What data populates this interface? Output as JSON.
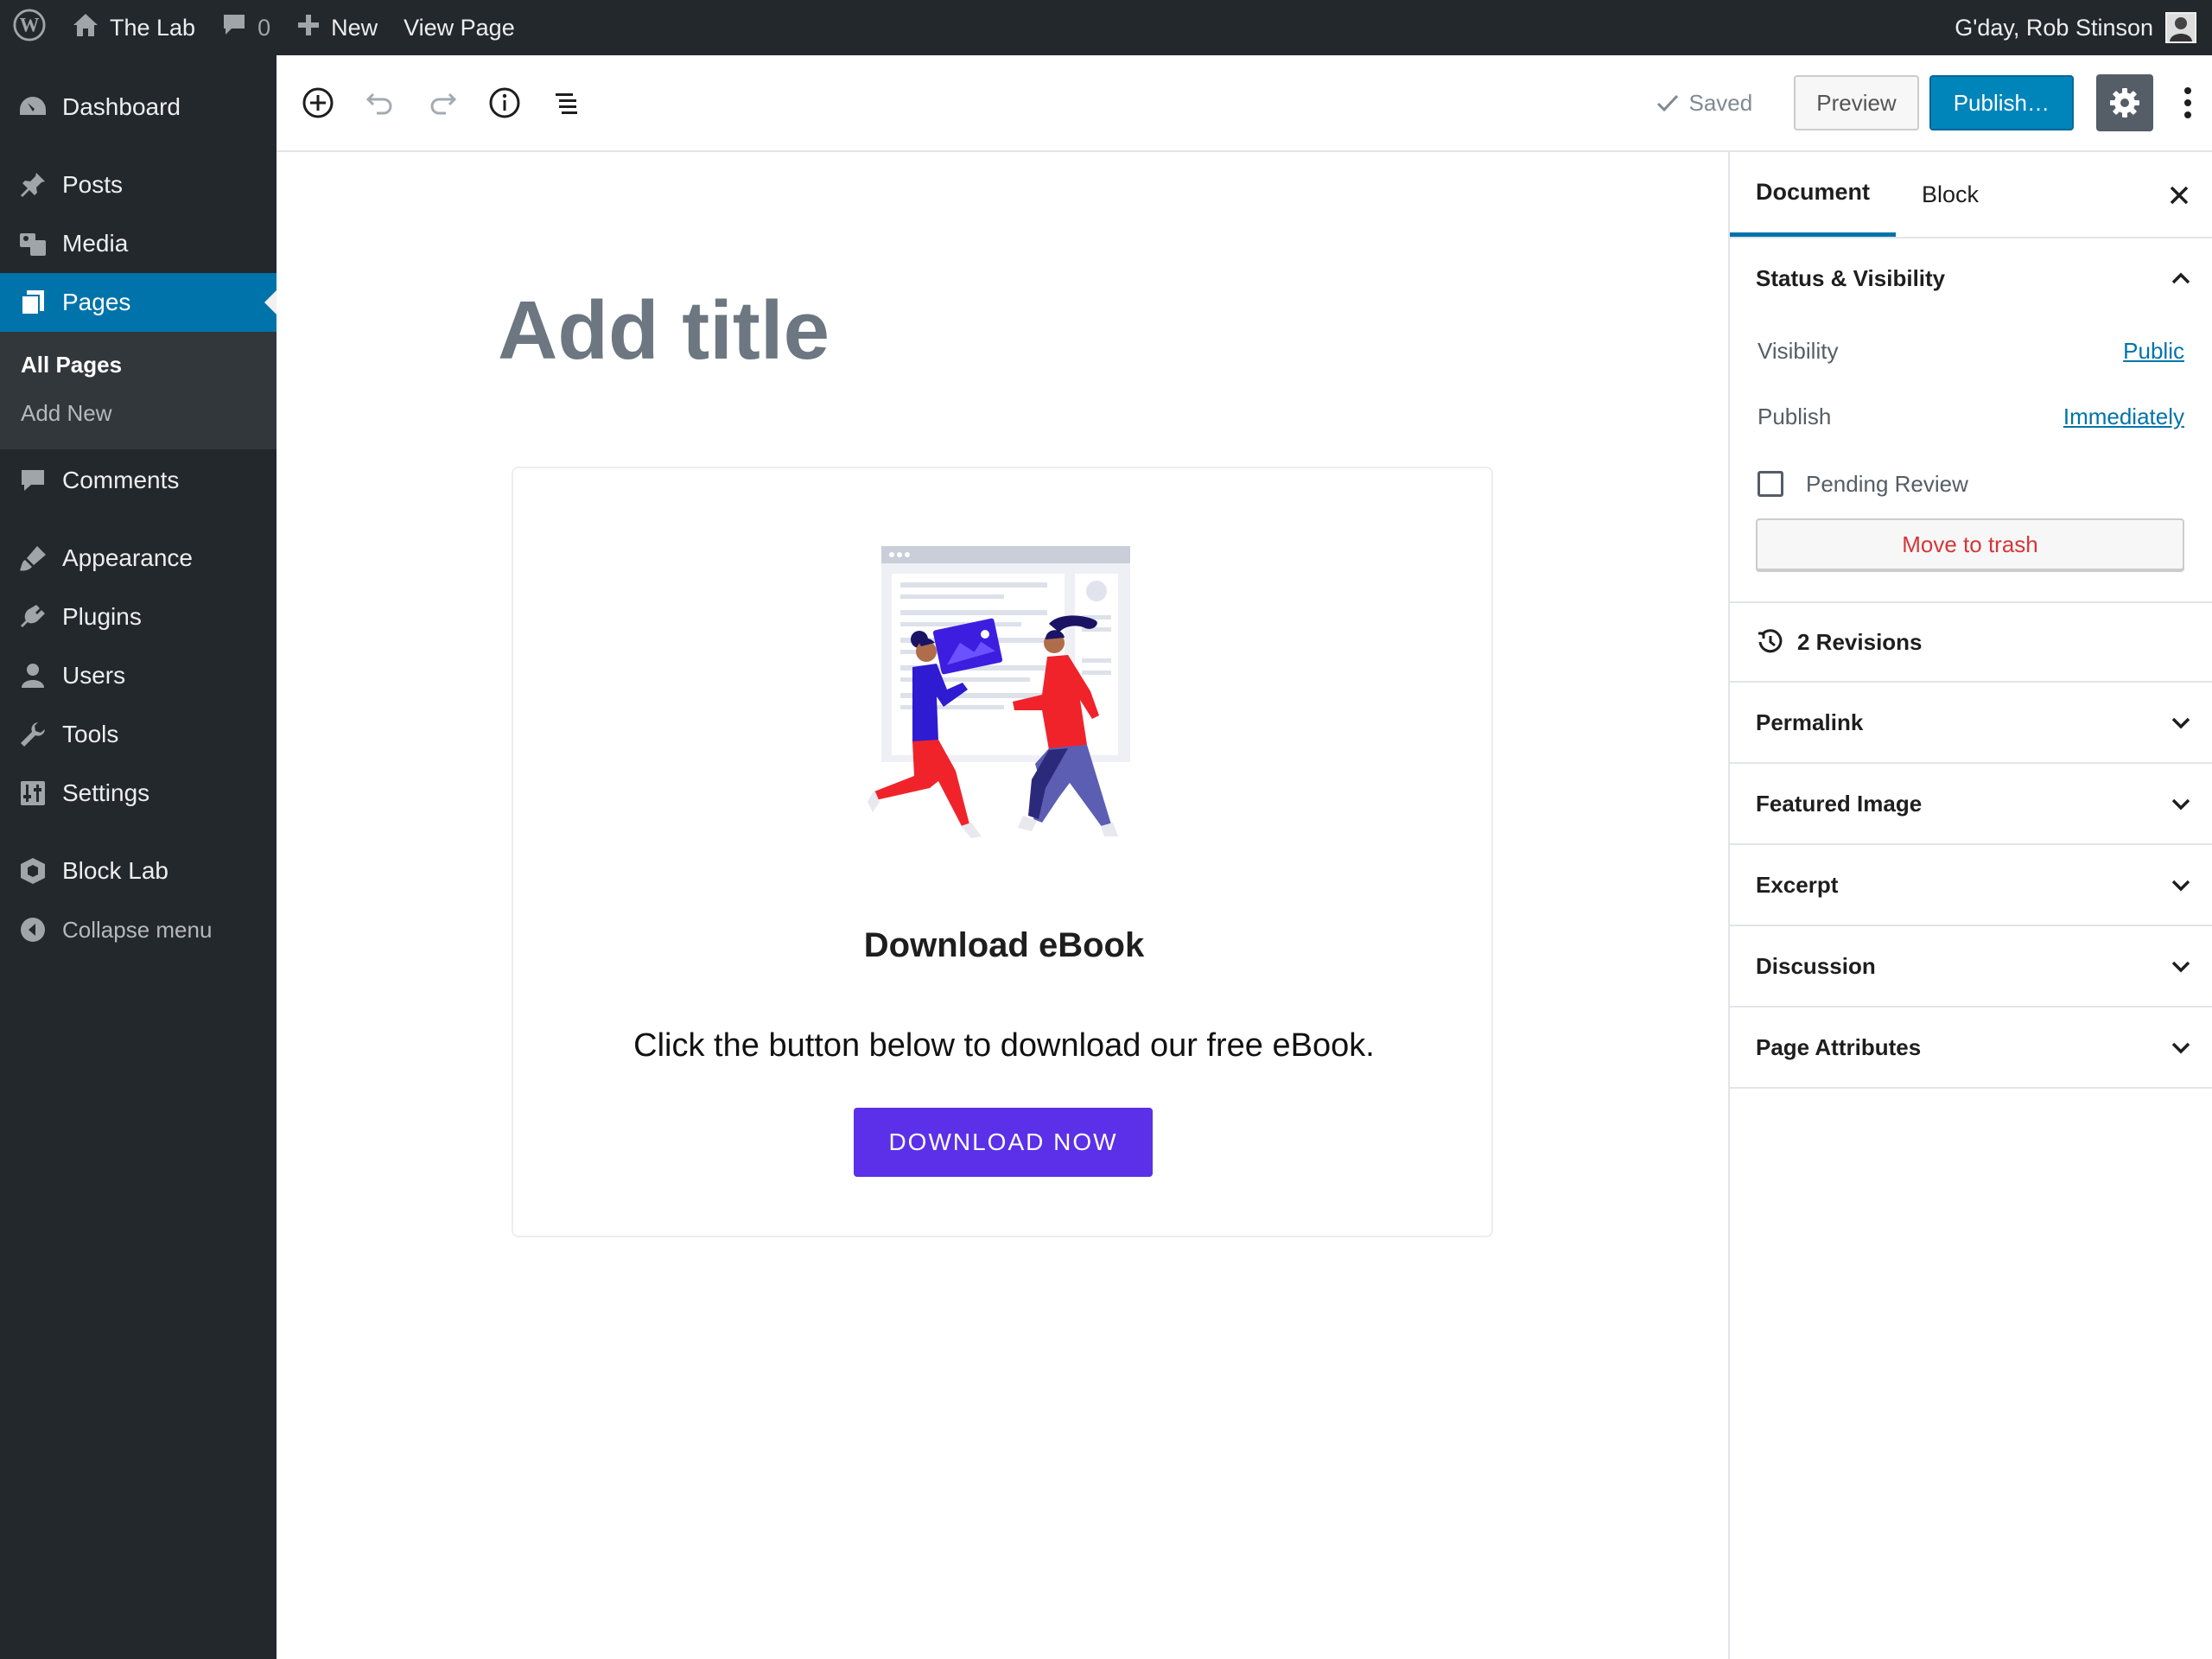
{
  "admin_bar": {
    "site_name": "The Lab",
    "comments_count": "0",
    "new_label": "New",
    "view_page_label": "View Page",
    "greeting": "G'day, Rob Stinson"
  },
  "sidebar": {
    "dashboard": "Dashboard",
    "posts": "Posts",
    "media": "Media",
    "pages": "Pages",
    "submenu": {
      "all_pages": "All Pages",
      "add_new": "Add New"
    },
    "comments": "Comments",
    "appearance": "Appearance",
    "plugins": "Plugins",
    "users": "Users",
    "tools": "Tools",
    "settings": "Settings",
    "block_lab": "Block Lab",
    "collapse": "Collapse menu"
  },
  "toolbar": {
    "saved_label": "Saved",
    "preview_label": "Preview",
    "publish_label": "Publish…"
  },
  "editor": {
    "title_placeholder": "Add title",
    "card": {
      "title": "Download eBook",
      "text": "Click the button below to download our free eBook.",
      "button_label": "DOWNLOAD NOW"
    }
  },
  "panel": {
    "tabs": {
      "document": "Document",
      "block": "Block"
    },
    "status_visibility": {
      "heading": "Status & Visibility",
      "visibility_label": "Visibility",
      "visibility_value": "Public",
      "publish_label": "Publish",
      "publish_value": "Immediately",
      "pending_review": "Pending Review",
      "trash_label": "Move to trash"
    },
    "revisions": "2 Revisions",
    "sections": {
      "permalink": "Permalink",
      "featured_image": "Featured Image",
      "excerpt": "Excerpt",
      "discussion": "Discussion",
      "page_attributes": "Page Attributes"
    }
  },
  "colors": {
    "admin_dark": "#23282d",
    "wp_blue": "#0073aa",
    "publish_blue": "#0085ba",
    "cta_purple": "#5b30e8",
    "trash_red": "#d63638"
  },
  "icons": [
    "wordpress-logo-icon",
    "home-icon",
    "comment-bubble-icon",
    "plus-icon",
    "dashboard-icon",
    "pin-icon",
    "media-icon",
    "pages-icon",
    "comments-icon",
    "appearance-icon",
    "plugins-icon",
    "users-icon",
    "tools-icon",
    "settings-icon",
    "block-lab-icon",
    "collapse-icon",
    "add-block-icon",
    "undo-icon",
    "redo-icon",
    "info-icon",
    "outline-icon",
    "check-icon",
    "gear-icon",
    "kebab-icon",
    "close-icon",
    "chevron-up-icon",
    "chevron-down-icon",
    "history-icon"
  ]
}
